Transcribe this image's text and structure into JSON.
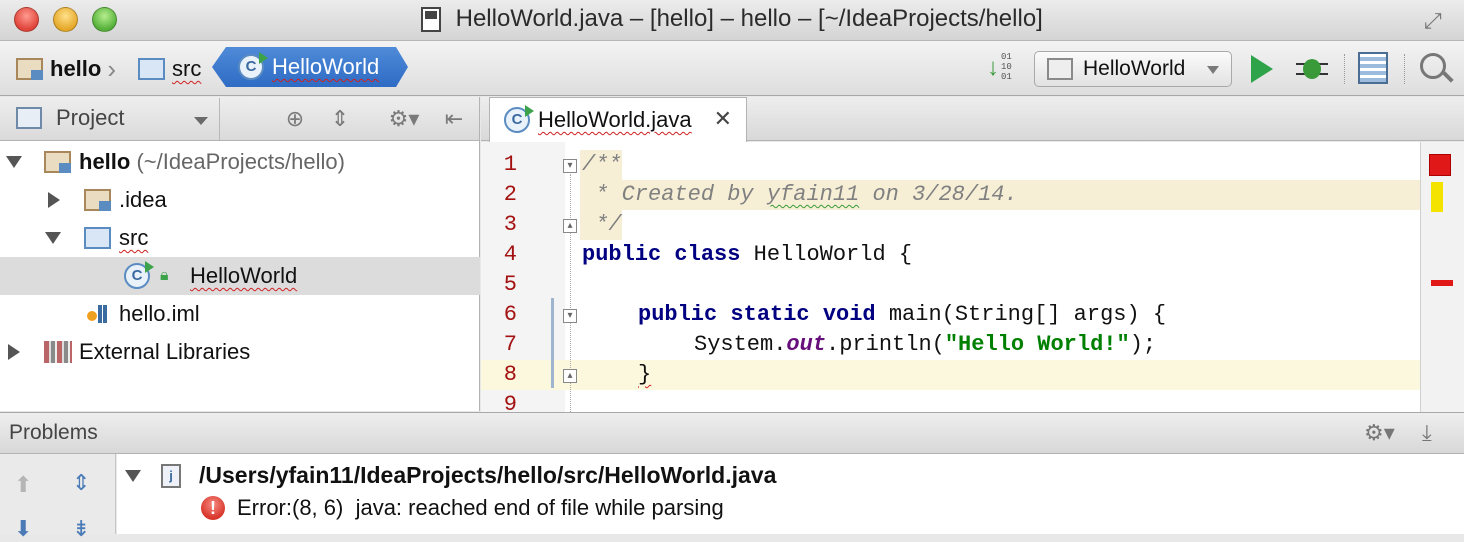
{
  "window": {
    "title": "HelloWorld.java – [hello] – hello – [~/IdeaProjects/hello]"
  },
  "breadcrumb": {
    "items": [
      "hello",
      "src"
    ],
    "active": "HelloWorld"
  },
  "toolbar": {
    "make_bits": [
      "01",
      "10",
      "01"
    ],
    "run_config": "HelloWorld"
  },
  "project_panel": {
    "title": "Project",
    "tree": [
      {
        "label": "hello",
        "path": "(~/IdeaProjects/hello)",
        "expanded": true,
        "icon": "module-folder-icon"
      },
      {
        "label": ".idea",
        "expanded": false,
        "icon": "folder-icon"
      },
      {
        "label": "src",
        "expanded": true,
        "icon": "source-folder-icon"
      },
      {
        "label": "HelloWorld",
        "icon": "java-class-icon",
        "selected": true
      },
      {
        "label": "hello.iml",
        "icon": "iml-file-icon"
      },
      {
        "label": "External Libraries",
        "expanded": false,
        "icon": "libraries-icon"
      }
    ]
  },
  "editor": {
    "tab": "HelloWorld.java",
    "line_numbers": [
      "1",
      "2",
      "3",
      "4",
      "5",
      "6",
      "7",
      "8",
      "9"
    ],
    "lines": {
      "l1": "/**",
      "l2_pre": " * Created by ",
      "l2_user": "yfain11",
      "l2_post": " on 3/28/14.",
      "l3": " */",
      "l4_kw": "public class",
      "l4_rest": " HelloWorld {",
      "l6_kw": "public static void",
      "l6_rest": " main(String[] args) {",
      "l7_pre": "System.",
      "l7_field": "out",
      "l7_mid": ".println(",
      "l7_str": "\"Hello World!\"",
      "l7_post": ");",
      "l8": "}"
    }
  },
  "problems": {
    "title": "Problems",
    "file": "/Users/yfain11/IdeaProjects/hello/src/HelloWorld.java",
    "message": "Error:(8, 6)  java: reached end of file while parsing"
  },
  "colors": {
    "keyword": "#000080",
    "string": "#008000",
    "comment": "#808080",
    "error": "#e01818",
    "breadcrumb_active": "#2e6bc4"
  }
}
